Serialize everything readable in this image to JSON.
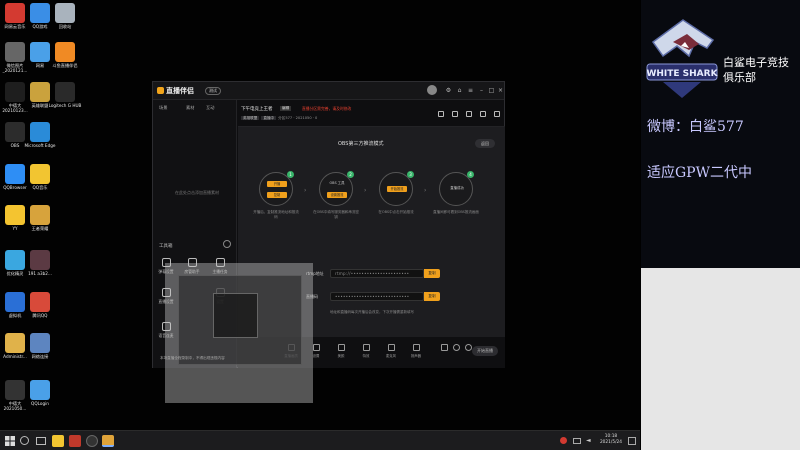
{
  "desktop": {
    "icons": [
      {
        "label": "网易云音乐",
        "color": "#d33a31"
      },
      {
        "label": "QQ游戏",
        "color": "#3a8ee6"
      },
      {
        "label": "回收站",
        "color": "#a9b3bd"
      },
      {
        "label": "微信图片\n_2020121...",
        "color": "#666666"
      },
      {
        "label": "网易",
        "color": "#4aa0e8"
      },
      {
        "label": "斗鱼直播伴侣",
        "color": "#f08a24"
      },
      {
        "label": "中德大\n20210123...",
        "color": "#1e1e1e"
      },
      {
        "label": "英雄联盟",
        "color": "#caa23d"
      },
      {
        "label": "Logitech G HUB",
        "color": "#2a2a2a"
      },
      {
        "label": "OBS",
        "color": "#2c2c2c"
      },
      {
        "label": "Microsoft Edge",
        "color": "#2a8bd8"
      },
      {
        "label": "QQBrowser",
        "color": "#2e8ef5"
      },
      {
        "label": "QQ音乐",
        "color": "#f2c531"
      },
      {
        "label": "YY",
        "color": "#f4c430"
      },
      {
        "label": "王者荣耀",
        "color": "#d7a33c"
      },
      {
        "label": "优化精灵",
        "color": "#3aa7e0"
      },
      {
        "label": "191 a3b2...",
        "color": "#5b3a43"
      },
      {
        "label": "虚拟机",
        "color": "#2a6fd6"
      },
      {
        "label": "腾讯QQ",
        "color": "#d84a3a"
      },
      {
        "label": "Administr...",
        "color": "#e0b24a"
      },
      {
        "label": "网络连接",
        "color": "#5d85c0"
      },
      {
        "label": "中德大\n2021050...",
        "color": "#333333"
      },
      {
        "label": "QQLogin",
        "color": "#4aa0e8"
      }
    ]
  },
  "taskbar": {
    "time": "10:18",
    "date": "2021/5/24"
  },
  "obs": {
    "app_name": "直播伴侣",
    "version_tag": "测试",
    "left_tabs": [
      "场景",
      "素材",
      "互动"
    ],
    "empty_hint": "在此处点击添加直播素材",
    "tools_title": "工具箱",
    "tools": [
      {
        "label": "弹幕设置"
      },
      {
        "label": "房管助手"
      },
      {
        "label": "主播任务"
      },
      {
        "label": "直播设置"
      },
      {
        "label": "语音连麦"
      },
      {
        "label": "设置"
      }
    ],
    "stream_title": "下午电竞上王者",
    "edit_badge": "编辑",
    "warn_text": "直播分区需完善，请及时修改",
    "meta_tags": [
      "英雄联盟",
      "直播中"
    ],
    "meta_text": "分区577 · 2021050 · 0",
    "panel_title": "OBS第三方推流模式",
    "back_label": "返回",
    "steps": [
      {
        "num": "1",
        "top_pill": "开播",
        "bottom_pill": "复制",
        "text": "开播后，复制推流地址和推流码"
      },
      {
        "num": "2",
        "top_pill": "",
        "bottom_pill": "设置推流",
        "circle_text": "OBS 工具",
        "text": "在OBS中填写服务器和串流密钥"
      },
      {
        "num": "3",
        "top_pill": "开始推流",
        "bottom_pill": "",
        "text": "在OBS中点击开始推流"
      },
      {
        "num": "4",
        "top_pill": "",
        "bottom_pill": "",
        "circle_text": "直播成功",
        "text": "直播间即可看到OBS推流画面"
      }
    ],
    "rtmp_label": "rtmp地址",
    "rtmp_value": "rtmp://••••••••••••••••••••••",
    "key_label": "直播码",
    "key_value": "••••••••••••••••••••••••••••",
    "copy_label": "复制",
    "copy_hint": "地址和直播码每次开播后会改变，下次开播需重新填写",
    "bottom_items": [
      {
        "label": "直播画质"
      },
      {
        "label": "设置"
      },
      {
        "label": "美颜"
      },
      {
        "label": "特效"
      },
      {
        "label": "麦克风"
      },
      {
        "label": "扬声器"
      }
    ],
    "start_label": "开始直播",
    "notice": "本场直播全程录制中，不得出现违规内容"
  },
  "sidebar": {
    "club_name_line1": "白鲨电子竞技",
    "club_name_line2": "俱乐部",
    "logo_text": "WHITE SHARK",
    "weibo": "微博：白鲨577",
    "slogan": "适应GPW二代中"
  }
}
